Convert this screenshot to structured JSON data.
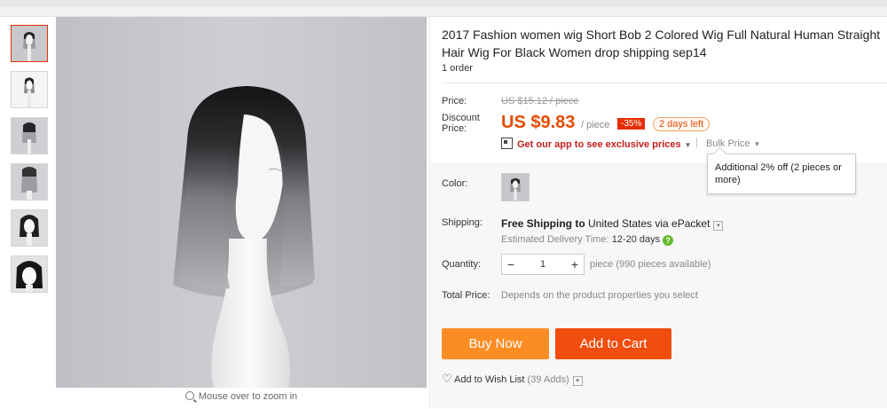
{
  "product": {
    "title": "2017 Fashion women wig Short Bob 2 Colored Wig Full Natural Human Straight Hair Wig For Black Women drop shipping sep14",
    "orders": "1 order"
  },
  "gallery": {
    "zoom_hint": "Mouse over to zoom in",
    "thumb_count": 6
  },
  "pricing": {
    "price_label": "Price:",
    "original_price": "US $15.12 / piece",
    "discount_label": "Discount Price:",
    "discount_price": "US $9.83",
    "per_unit": "/ piece",
    "discount_badge": "-35%",
    "time_left": "2 days left",
    "app_promo": "Get our app to see exclusive prices",
    "bulk_price": "Bulk Price",
    "bulk_tooltip": "Additional 2% off (2 pieces or more)"
  },
  "options": {
    "color_label": "Color:",
    "shipping_label": "Shipping:",
    "shipping_free": "Free Shipping to",
    "shipping_dest": " United States via ePacket",
    "delivery_label": "Estimated Delivery Time: ",
    "delivery_days": "12-20 days",
    "quantity_label": "Quantity:",
    "quantity_value": "1",
    "quantity_minus": "−",
    "quantity_plus": "+",
    "availability": "piece (990 pieces available)",
    "total_label": "Total Price:",
    "total_text": "Depends on the product properties you select"
  },
  "actions": {
    "buy_now": "Buy Now",
    "add_to_cart": "Add to Cart",
    "wish_list": "Add to Wish List",
    "wish_count": " (39 Adds)"
  },
  "colors": {
    "price_orange": "#e64b00",
    "buy_now_bg": "#fc8d24",
    "add_to_cart_bg": "#f04d0e",
    "badge_red": "#e62e04",
    "promo_red": "#c0201e",
    "help_green": "#68b82e"
  }
}
